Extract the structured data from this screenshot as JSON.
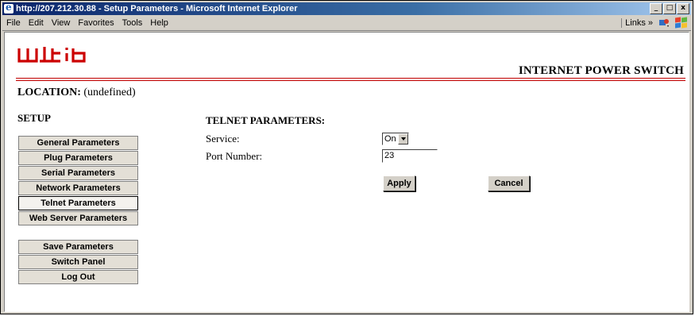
{
  "window": {
    "title": "http://207.212.30.88 - Setup Parameters - Microsoft Internet Explorer",
    "minimize_glyph": "_",
    "maximize_glyph": "□",
    "close_glyph": "x"
  },
  "menubar": {
    "items": [
      "File",
      "Edit",
      "View",
      "Favorites",
      "Tools",
      "Help"
    ],
    "links_label": "Links »"
  },
  "header": {
    "product_name": "INTERNET POWER SWITCH",
    "logo_color": "#cc0000",
    "accent_line_color": "#c00000"
  },
  "location": {
    "label": "LOCATION:",
    "value": "(undefined)"
  },
  "sidebar": {
    "title": "SETUP",
    "nav": [
      {
        "label": "General Parameters",
        "active": false
      },
      {
        "label": "Plug Parameters",
        "active": false
      },
      {
        "label": "Serial Parameters",
        "active": false
      },
      {
        "label": "Network Parameters",
        "active": false
      },
      {
        "label": "Telnet Parameters",
        "active": true
      },
      {
        "label": "Web Server Parameters",
        "active": false
      }
    ],
    "actions": [
      {
        "label": "Save Parameters"
      },
      {
        "label": "Switch Panel"
      },
      {
        "label": "Log Out"
      }
    ]
  },
  "form": {
    "title": "TELNET PARAMETERS:",
    "service_label": "Service:",
    "service_value": "On",
    "port_label": "Port Number:",
    "port_value": "23",
    "apply_label": "Apply",
    "cancel_label": "Cancel"
  }
}
